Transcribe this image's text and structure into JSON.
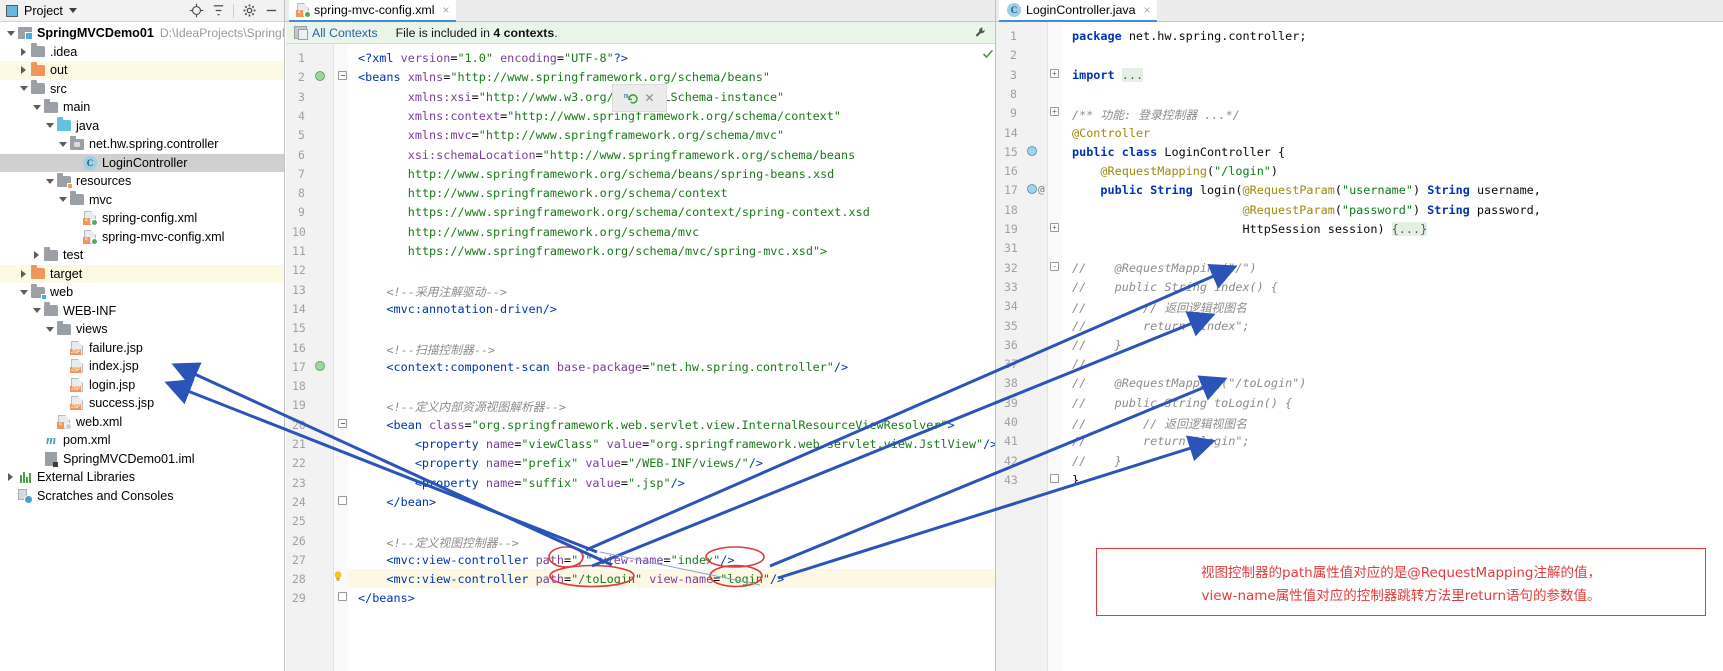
{
  "project_panel": {
    "title": "Project",
    "toolbar_icons": [
      "locate-icon",
      "collapse-all-icon",
      "settings-gear-icon",
      "hide-icon"
    ],
    "tree": [
      {
        "indent": 0,
        "arrow": "down",
        "icon": "module-icon",
        "label": "SpringMVCDemo01",
        "bold": true,
        "path": "D:\\IdeaProjects\\SpringM",
        "hl": "none"
      },
      {
        "indent": 1,
        "arrow": "right",
        "icon": "folder-icon",
        "label": ".idea",
        "hl": "none"
      },
      {
        "indent": 1,
        "arrow": "right",
        "icon": "folder-orange-icon",
        "label": "out",
        "hl": "yellow"
      },
      {
        "indent": 1,
        "arrow": "down",
        "icon": "folder-icon",
        "label": "src",
        "hl": "none"
      },
      {
        "indent": 2,
        "arrow": "down",
        "icon": "folder-icon",
        "label": "main",
        "hl": "none"
      },
      {
        "indent": 3,
        "arrow": "down",
        "icon": "folder-blue-icon",
        "label": "java",
        "hl": "none"
      },
      {
        "indent": 4,
        "arrow": "down",
        "icon": "package-icon",
        "label": "net.hw.spring.controller",
        "hl": "none"
      },
      {
        "indent": 5,
        "arrow": "none",
        "icon": "java-class-icon",
        "label": "LoginController",
        "hl": "selected"
      },
      {
        "indent": 3,
        "arrow": "down",
        "icon": "folder-resources-icon",
        "label": "resources",
        "hl": "none"
      },
      {
        "indent": 4,
        "arrow": "down",
        "icon": "folder-icon",
        "label": "mvc",
        "hl": "none"
      },
      {
        "indent": 5,
        "arrow": "none",
        "icon": "xml-spring-file-icon",
        "label": "spring-config.xml",
        "hl": "none"
      },
      {
        "indent": 5,
        "arrow": "none",
        "icon": "xml-spring-file-icon",
        "label": "spring-mvc-config.xml",
        "hl": "none"
      },
      {
        "indent": 2,
        "arrow": "right",
        "icon": "folder-icon",
        "label": "test",
        "hl": "none"
      },
      {
        "indent": 1,
        "arrow": "right",
        "icon": "folder-orange-icon",
        "label": "target",
        "hl": "yellow"
      },
      {
        "indent": 1,
        "arrow": "down",
        "icon": "web-folder-icon",
        "label": "web",
        "hl": "none"
      },
      {
        "indent": 2,
        "arrow": "down",
        "icon": "folder-icon",
        "label": "WEB-INF",
        "hl": "none"
      },
      {
        "indent": 3,
        "arrow": "down",
        "icon": "folder-icon",
        "label": "views",
        "hl": "none"
      },
      {
        "indent": 4,
        "arrow": "none",
        "icon": "jsp-file-icon",
        "label": "failure.jsp",
        "hl": "none"
      },
      {
        "indent": 4,
        "arrow": "none",
        "icon": "jsp-file-icon",
        "label": "index.jsp",
        "hl": "none"
      },
      {
        "indent": 4,
        "arrow": "none",
        "icon": "jsp-file-icon",
        "label": "login.jsp",
        "hl": "none"
      },
      {
        "indent": 4,
        "arrow": "none",
        "icon": "jsp-file-icon",
        "label": "success.jsp",
        "hl": "none"
      },
      {
        "indent": 3,
        "arrow": "none",
        "icon": "xml-file-icon",
        "label": "web.xml",
        "hl": "none"
      },
      {
        "indent": 2,
        "arrow": "none",
        "icon": "maven-icon",
        "label": "pom.xml",
        "hl": "none"
      },
      {
        "indent": 2,
        "arrow": "none",
        "icon": "iml-file-icon",
        "label": "SpringMVCDemo01.iml",
        "hl": "none"
      },
      {
        "indent": 0,
        "arrow": "right",
        "icon": "libraries-icon",
        "label": "External Libraries",
        "hl": "none"
      },
      {
        "indent": 0,
        "arrow": "none",
        "icon": "scratches-icon",
        "label": "Scratches and Consoles",
        "hl": "none"
      }
    ]
  },
  "editor_left": {
    "tab": {
      "label": "spring-mvc-config.xml",
      "icon": "xml-spring-file-icon",
      "close": "×"
    },
    "context_bar": {
      "link": "All Contexts",
      "text_pre": "File is included in ",
      "text_bold": "4 contexts",
      "text_post": ".",
      "wrench": "wrench-icon"
    },
    "lines": [
      {
        "n": 1,
        "text": "<?xml version=\"1.0\" encoding=\"UTF-8\"?>"
      },
      {
        "n": 2,
        "text": "<beans xmlns=\"http://www.springframework.org/schema/beans\""
      },
      {
        "n": 3,
        "text": "       xmlns:xsi=\"http://www.w3.org/2001/XMLSchema-instance\""
      },
      {
        "n": 4,
        "text": "       xmlns:context=\"http://www.springframework.org/schema/context\""
      },
      {
        "n": 5,
        "text": "       xmlns:mvc=\"http://www.springframework.org/schema/mvc\""
      },
      {
        "n": 6,
        "text": "       xsi:schemaLocation=\"http://www.springframework.org/schema/beans"
      },
      {
        "n": 7,
        "text": "       http://www.springframework.org/schema/beans/spring-beans.xsd"
      },
      {
        "n": 8,
        "text": "       http://www.springframework.org/schema/context"
      },
      {
        "n": 9,
        "text": "       https://www.springframework.org/schema/context/spring-context.xsd"
      },
      {
        "n": 10,
        "text": "       http://www.springframework.org/schema/mvc"
      },
      {
        "n": 11,
        "text": "       https://www.springframework.org/schema/mvc/spring-mvc.xsd\">"
      },
      {
        "n": 12,
        "text": ""
      },
      {
        "n": 13,
        "text": "    <!--采用注解驱动-->"
      },
      {
        "n": 14,
        "text": "    <mvc:annotation-driven/>"
      },
      {
        "n": 15,
        "text": ""
      },
      {
        "n": 16,
        "text": "    <!--扫描控制器-->"
      },
      {
        "n": 17,
        "text": "    <context:component-scan base-package=\"net.hw.spring.controller\"/>"
      },
      {
        "n": 18,
        "text": ""
      },
      {
        "n": 19,
        "text": "    <!--定义内部资源视图解析器-->"
      },
      {
        "n": 20,
        "text": "    <bean class=\"org.springframework.web.servlet.view.InternalResourceViewResolver\">"
      },
      {
        "n": 21,
        "text": "        <property name=\"viewClass\" value=\"org.springframework.web.servlet.view.JstlView\"/>"
      },
      {
        "n": 22,
        "text": "        <property name=\"prefix\" value=\"/WEB-INF/views/\"/>"
      },
      {
        "n": 23,
        "text": "        <property name=\"suffix\" value=\".jsp\"/>"
      },
      {
        "n": 24,
        "text": "    </bean>"
      },
      {
        "n": 25,
        "text": ""
      },
      {
        "n": 26,
        "text": "    <!--定义视图控制器-->"
      },
      {
        "n": 27,
        "text": "    <mvc:view-controller path=\"/\" view-name=\"index\"/>"
      },
      {
        "n": 28,
        "text": "    <mvc:view-controller path=\"/toLogin\" view-name=\"login\"/>"
      },
      {
        "n": 29,
        "text": "</beans>"
      }
    ]
  },
  "editor_right": {
    "tab": {
      "label": "LoginController.java",
      "icon": "java-class-icon",
      "close": "×"
    },
    "lines": [
      {
        "n": 1,
        "text": "package net.hw.spring.controller;"
      },
      {
        "n": 2,
        "text": ""
      },
      {
        "n": 3,
        "text": "import ..."
      },
      {
        "n": 8,
        "text": ""
      },
      {
        "n": 9,
        "text": "/** 功能: 登录控制器 ...*/"
      },
      {
        "n": 14,
        "text": "@Controller"
      },
      {
        "n": 15,
        "text": "public class LoginController {"
      },
      {
        "n": 16,
        "text": "    @RequestMapping(\"/login\")"
      },
      {
        "n": 17,
        "text": "    public String login(@RequestParam(\"username\") String username,"
      },
      {
        "n": 18,
        "text": "                        @RequestParam(\"password\") String password,"
      },
      {
        "n": 19,
        "text": "                        HttpSession session) {...}"
      },
      {
        "n": 31,
        "text": ""
      },
      {
        "n": 32,
        "text": "//    @RequestMapping(\"/\")"
      },
      {
        "n": 33,
        "text": "//    public String index() {"
      },
      {
        "n": 34,
        "text": "//        // 返回逻辑视图名"
      },
      {
        "n": 35,
        "text": "//        return \"index\";"
      },
      {
        "n": 36,
        "text": "//    }"
      },
      {
        "n": 37,
        "text": "//"
      },
      {
        "n": 38,
        "text": "//    @RequestMapping(\"/toLogin\")"
      },
      {
        "n": 39,
        "text": "//    public String toLogin() {"
      },
      {
        "n": 40,
        "text": "//        // 返回逻辑视图名"
      },
      {
        "n": 41,
        "text": "//        return \"login\";"
      },
      {
        "n": 42,
        "text": "//    }"
      },
      {
        "n": 43,
        "text": "}"
      }
    ]
  },
  "annotation": {
    "line1": "视图控制器的path属性值对应的是@RequestMapping注解的值，",
    "line2": "view-name属性值对应的控制器跳转方法里return语句的参数值。",
    "color": "#e33b3b"
  },
  "colors": {
    "accent": "#3f8cd9",
    "arrow_blue": "#2a54b8",
    "circle_red": "#e03a3a",
    "annotation_red": "#e33b3b",
    "highlight_yellow": "#fdfae3"
  }
}
